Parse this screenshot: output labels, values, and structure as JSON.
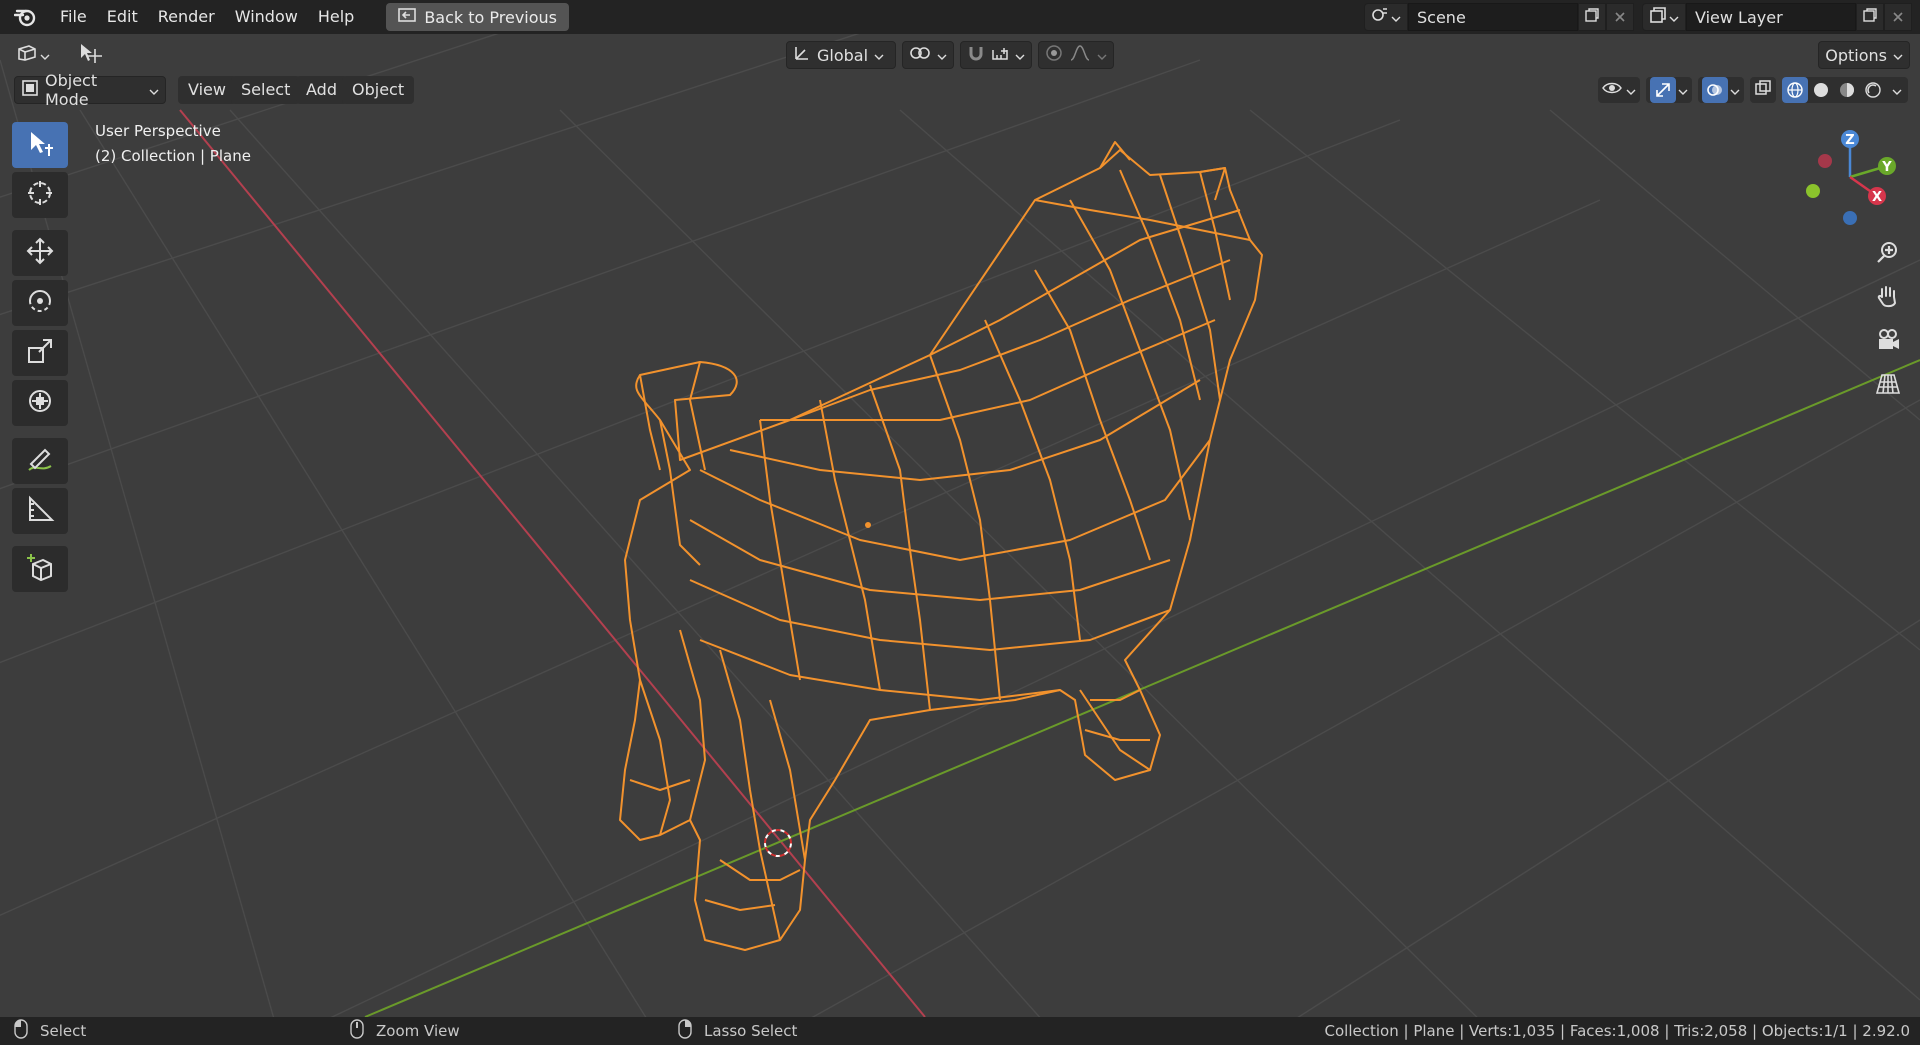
{
  "topbar": {
    "menus": [
      "File",
      "Edit",
      "Render",
      "Window",
      "Help"
    ],
    "back_label": "Back to Previous",
    "scene_name": "Scene",
    "view_layer_name": "View Layer"
  },
  "header": {
    "orientation_label": "Global",
    "options_label": "Options",
    "mode_label": "Object Mode",
    "menus": [
      "View",
      "Select",
      "Add",
      "Object"
    ]
  },
  "viewport": {
    "perspective_label": "User Perspective",
    "collection_label": "(2) Collection | Plane",
    "axes": {
      "x": "X",
      "y": "Y",
      "z": "Z"
    },
    "mesh_color": "#f2922d",
    "x_axis_color": "#b3404f",
    "y_axis_color": "#6a9a2a"
  },
  "statusbar": {
    "left_action": "Select",
    "middle_action": "Zoom View",
    "right_action": "Lasso Select",
    "stats": "Collection | Plane | Verts:1,035 | Faces:1,008 | Tris:2,058 | Objects:1/1 | 2.92.0"
  }
}
